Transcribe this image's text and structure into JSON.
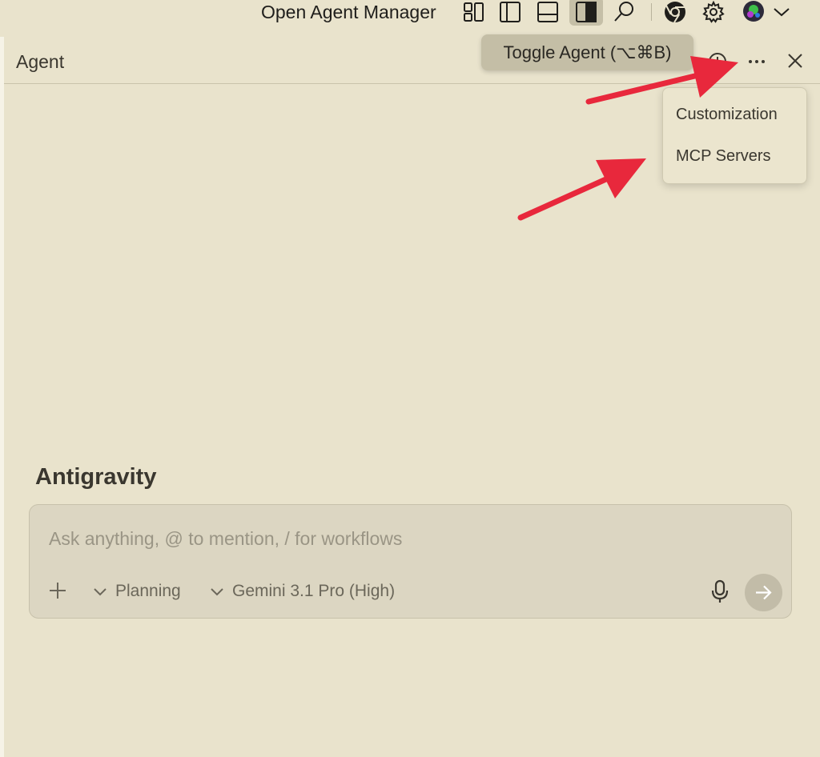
{
  "topbar": {
    "open_agent_manager_label": "Open Agent Manager",
    "icons": [
      "layout-icon",
      "panel-left-icon",
      "panel-bottom-icon",
      "toggle-agent-panel-icon",
      "search-icon",
      "chrome-icon",
      "gear-icon",
      "avatar",
      "chevron-down-icon"
    ]
  },
  "tooltip": {
    "text": "Toggle Agent (⌥⌘B)"
  },
  "panel": {
    "title": "Agent"
  },
  "menu": {
    "items": [
      "Customization",
      "MCP Servers"
    ]
  },
  "main": {
    "title": "Antigravity",
    "input_placeholder": "Ask anything, @ to mention, / for workflows",
    "input_value": "",
    "mode_label": "Planning",
    "model_label": "Gemini 3.1 Pro (High)"
  },
  "colors": {
    "background": "#e9e3cc",
    "composer": "#dcd6c2",
    "tooltip": "#c4bea6",
    "annotation_arrow": "#e8283c"
  }
}
